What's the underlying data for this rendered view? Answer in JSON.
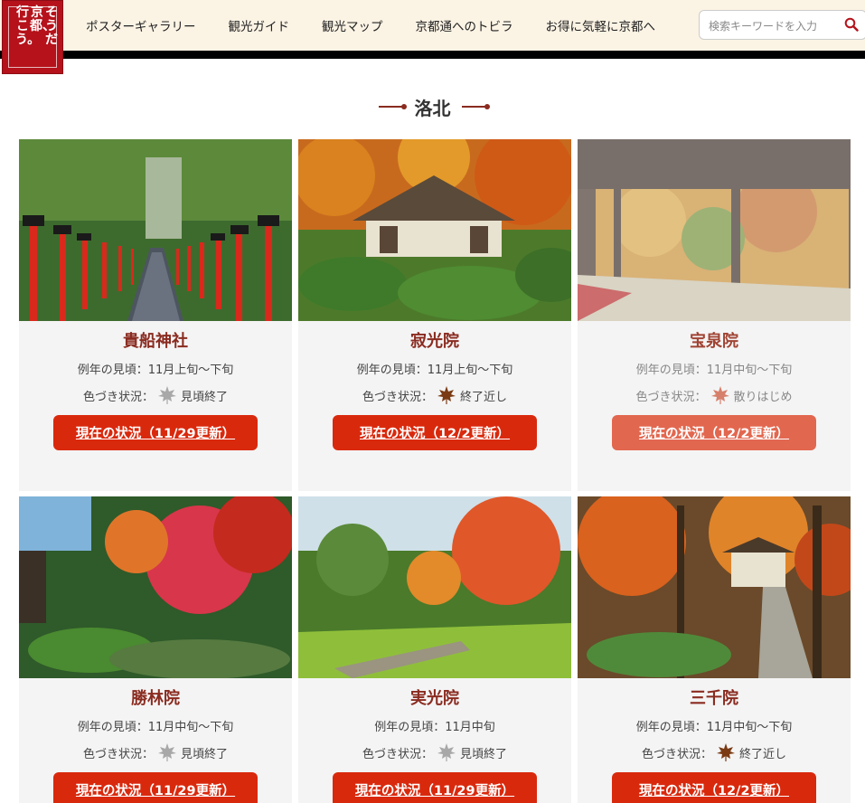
{
  "logo": {
    "col1": "そうだ",
    "col2": "京都、",
    "col3": "行こう。"
  },
  "nav": [
    "ポスターギャラリー",
    "観光ガイド",
    "観光マップ",
    "京都通へのトビラ",
    "お得に気軽に京都へ"
  ],
  "search": {
    "placeholder": "検索キーワードを入力"
  },
  "section": {
    "title": "洛北"
  },
  "status_label": "色づき状況：",
  "spots": [
    {
      "name": "貴船神社",
      "season": "例年の見頃：11月上旬〜下旬",
      "status": "見頃終了",
      "leaf": "gray-maple-icon",
      "button": "現在の状況（11/29更新）"
    },
    {
      "name": "寂光院",
      "season": "例年の見頃：11月上旬〜下旬",
      "status": "終了近し",
      "leaf": "brown-maple-icon",
      "button": "現在の状況（12/2更新）"
    },
    {
      "name": "宝泉院",
      "season": "例年の見頃：11月中旬〜下旬",
      "status": "散りはじめ",
      "leaf": "red-maple-icon",
      "button": "現在の状況（12/2更新）"
    },
    {
      "name": "勝林院",
      "season": "例年の見頃：11月中旬〜下旬",
      "status": "見頃終了",
      "leaf": "gray-maple-icon",
      "button": "現在の状況（11/29更新）"
    },
    {
      "name": "実光院",
      "season": "例年の見頃：11月中旬",
      "status": "見頃終了",
      "leaf": "gray-maple-icon",
      "button": "現在の状況（11/29更新）"
    },
    {
      "name": "三千院",
      "season": "例年の見頃：11月中旬〜下旬",
      "status": "終了近し",
      "leaf": "brown-maple-icon",
      "button": "現在の状況（12/2更新）"
    }
  ],
  "colors": {
    "accent": "#d9290d",
    "title": "#8a2b20",
    "logo": "#b5121b",
    "header_bg": "#fbf3e4"
  }
}
